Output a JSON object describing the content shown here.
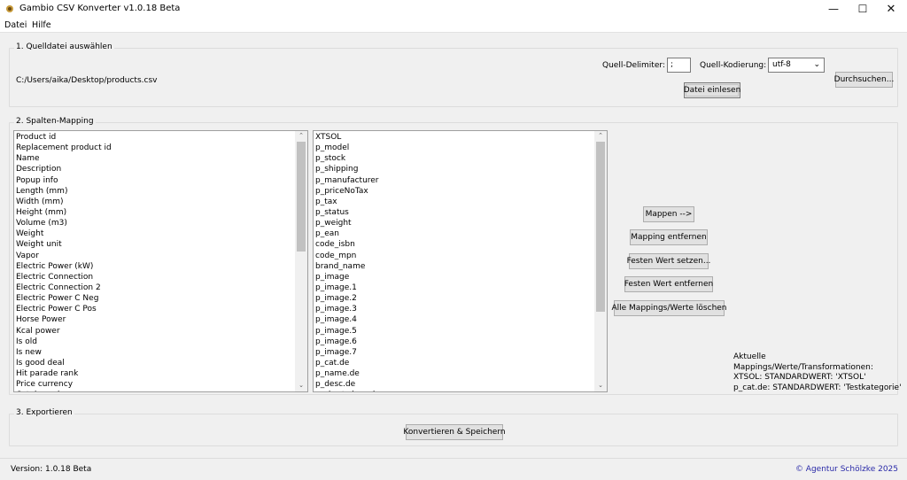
{
  "window": {
    "title": "Gambio CSV Konverter v1.0.18 Beta",
    "minimize": "—",
    "maximize": "☐",
    "close": "✕"
  },
  "menu": {
    "datei": "Datei",
    "hilfe": "Hilfe"
  },
  "source": {
    "group_label": "1. Quelldatei auswählen",
    "file_path": "C:/Users/aika/Desktop/products.csv",
    "delimiter_label": "Quell-Delimiter:",
    "delimiter_value": ";",
    "encoding_label": "Quell-Kodierung:",
    "encoding_value": "utf-8",
    "read_button": "Datei einlesen",
    "browse_button": "Durchsuchen..."
  },
  "mapping": {
    "group_label": "2. Spalten-Mapping",
    "source_columns": [
      "Product id",
      "Replacement product id",
      "Name",
      "Description",
      "Popup info",
      "Length (mm)",
      "Width (mm)",
      "Height (mm)",
      "Volume (m3)",
      "Weight",
      "Weight unit",
      "Vapor",
      "Electric Power (kW)",
      "Electric Connection",
      "Electric Connection 2",
      "Electric Power C Neg",
      "Electric Power C Pos",
      "Horse Power",
      "Kcal power",
      "Is old",
      "Is new",
      "Is good deal",
      "Hit parade rank",
      "Price currency",
      "Catalog price"
    ],
    "target_columns": [
      "XTSOL",
      "p_model",
      "p_stock",
      "p_shipping",
      "p_manufacturer",
      "p_priceNoTax",
      "p_tax",
      "p_status",
      "p_weight",
      "p_ean",
      "code_isbn",
      "code_mpn",
      "brand_name",
      "p_image",
      "p_image.1",
      "p_image.2",
      "p_image.3",
      "p_image.4",
      "p_image.5",
      "p_image.6",
      "p_image.7",
      "p_cat.de",
      "p_name.de",
      "p_desc.de",
      "p_short_desc.de"
    ],
    "buttons": {
      "map": "Mappen -->",
      "remove_mapping": "Mapping entfernen",
      "set_fixed": "Festen Wert setzen...",
      "remove_fixed": "Festen Wert entfernen",
      "clear_all": "Alle Mappings/Werte löschen"
    },
    "info": {
      "heading": "Aktuelle Mappings/Werte/Transformationen:",
      "lines": [
        "XTSOL: STANDARDWERT: 'XTSOL'",
        "p_cat.de: STANDARDWERT: 'Testkategorie'"
      ]
    }
  },
  "export": {
    "group_label": "3. Exportieren",
    "convert_button": "Konvertieren & Speichern"
  },
  "status": {
    "version": "Version: 1.0.18 Beta",
    "copyright": "© Agentur Schölzke 2025"
  },
  "colors": {
    "copyright": "#2a2aa8",
    "scroll_thumb": "#c1c1c1"
  },
  "icons": {
    "app": "app-icon",
    "select_arrow": "chevron-down-icon",
    "scroll_up": "chevron-up-icon",
    "scroll_down": "chevron-down-icon"
  }
}
